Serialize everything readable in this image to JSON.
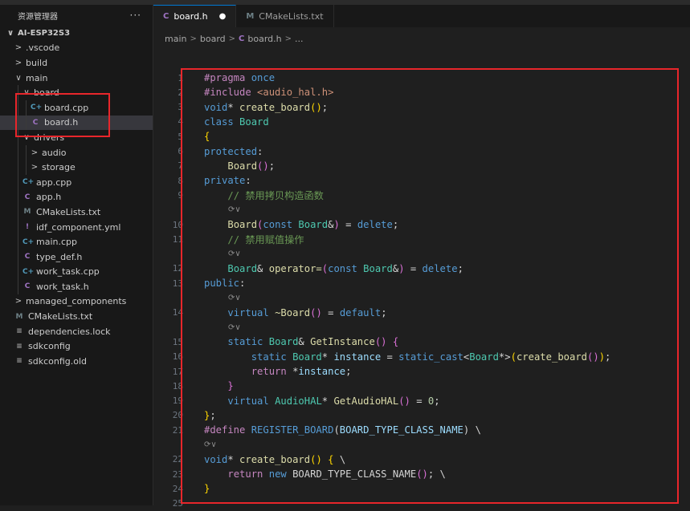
{
  "sidebar": {
    "title": "资源管理器",
    "more_label": "···",
    "items": [
      {
        "label": "AI-ESP32S3",
        "chev": "∨",
        "icon": "",
        "indent": 0
      },
      {
        "label": ".vscode",
        "chev": ">",
        "icon": "",
        "indent": 1
      },
      {
        "label": "build",
        "chev": ">",
        "icon": "",
        "indent": 1
      },
      {
        "label": "main",
        "chev": "∨",
        "icon": "",
        "indent": 1
      },
      {
        "label": "board",
        "chev": "∨",
        "icon": "",
        "indent": 2
      },
      {
        "label": "board.cpp",
        "chev": "",
        "icon": "C+",
        "indent": 3
      },
      {
        "label": "board.h",
        "chev": "",
        "icon": "C",
        "indent": 3
      },
      {
        "label": "drivers",
        "chev": "∨",
        "icon": "",
        "indent": 2
      },
      {
        "label": "audio",
        "chev": ">",
        "icon": "",
        "indent": 3
      },
      {
        "label": "storage",
        "chev": ">",
        "icon": "",
        "indent": 3
      },
      {
        "label": "app.cpp",
        "chev": "",
        "icon": "C+",
        "indent": 2
      },
      {
        "label": "app.h",
        "chev": "",
        "icon": "C",
        "indent": 2
      },
      {
        "label": "CMakeLists.txt",
        "chev": "",
        "icon": "M",
        "indent": 2
      },
      {
        "label": "idf_component.yml",
        "chev": "",
        "icon": "!",
        "indent": 2
      },
      {
        "label": "main.cpp",
        "chev": "",
        "icon": "C+",
        "indent": 2
      },
      {
        "label": "type_def.h",
        "chev": "",
        "icon": "C",
        "indent": 2
      },
      {
        "label": "work_task.cpp",
        "chev": "",
        "icon": "C+",
        "indent": 2
      },
      {
        "label": "work_task.h",
        "chev": "",
        "icon": "C",
        "indent": 2
      },
      {
        "label": "managed_components",
        "chev": ">",
        "icon": "",
        "indent": 1
      },
      {
        "label": "CMakeLists.txt",
        "chev": "",
        "icon": "M",
        "indent": 1
      },
      {
        "label": "dependencies.lock",
        "chev": "",
        "icon": "≡",
        "indent": 1
      },
      {
        "label": "sdkconfig",
        "chev": "",
        "icon": "≡",
        "indent": 1
      },
      {
        "label": "sdkconfig.old",
        "chev": "",
        "icon": "≡",
        "indent": 1
      }
    ]
  },
  "tabs": [
    {
      "icon": "C",
      "label": "board.h",
      "modified": "●"
    },
    {
      "icon": "M",
      "label": "CMakeLists.txt"
    }
  ],
  "breadcrumb": {
    "parts": [
      "main",
      "board",
      "board.h",
      "..."
    ],
    "icon": "C"
  },
  "code_lens": "⟳∨",
  "colors": {
    "accent": "#0078d4",
    "highlight_box": "#e8262b",
    "selection": "#37373d"
  }
}
